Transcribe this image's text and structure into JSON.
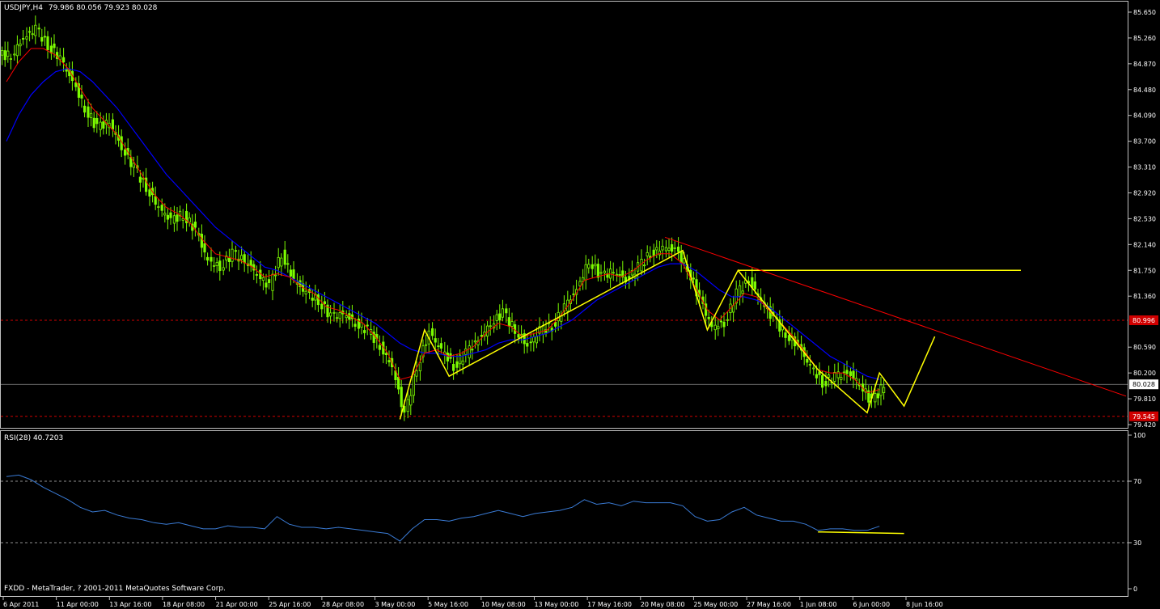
{
  "header": {
    "symbol": "USDJPY,H4",
    "ohlc": "79.986 80.056 79.923 80.028"
  },
  "footer": {
    "copyright": "FXDD - MetaTrader, ? 2001-2011 MetaQuotes Software Corp."
  },
  "colors": {
    "background": "#000000",
    "bull_candle": "#7cfc00",
    "ma_fast": "#ff0000",
    "ma_slow": "#0000ff",
    "pattern": "#ffff00",
    "trendline": "#ff0000",
    "rsi": "#3a7bd5",
    "grid_line": "#c0c0c0"
  },
  "chart_data": [
    {
      "type": "line",
      "panel": "price",
      "title": "USDJPY,H4",
      "y_ticks": [
        "85.650",
        "85.260",
        "84.870",
        "84.480",
        "84.090",
        "83.700",
        "83.310",
        "82.920",
        "82.530",
        "82.140",
        "81.750",
        "81.360",
        "80.590",
        "80.200",
        "79.810",
        "79.420"
      ],
      "ylim": [
        79.42,
        85.65
      ],
      "x_ticks": [
        "6 Apr 2011",
        "11 Apr 00:00",
        "13 Apr 16:00",
        "18 Apr 08:00",
        "21 Apr 00:00",
        "25 Apr 16:00",
        "28 Apr 08:00",
        "3 May 00:00",
        "5 May 16:00",
        "10 May 08:00",
        "13 May 00:00",
        "17 May 16:00",
        "20 May 08:00",
        "25 May 00:00",
        "27 May 16:00",
        "1 Jun 08:00",
        "6 Jun 00:00",
        "8 Jun 16:00"
      ],
      "price_labels": {
        "current": "80.028",
        "upper_level": "80.996",
        "lower_level": "79.545"
      },
      "levels": {
        "current": 80.028,
        "upper_level": 80.996,
        "lower_level": 79.545,
        "resistance": 81.75
      },
      "close_series": [
        {
          "x": 0,
          "y": 85.0
        },
        {
          "x": 1,
          "y": 85.25
        },
        {
          "x": 2,
          "y": 85.4
        },
        {
          "x": 3,
          "y": 85.15
        },
        {
          "x": 4,
          "y": 84.95
        },
        {
          "x": 5,
          "y": 84.6
        },
        {
          "x": 6,
          "y": 84.2
        },
        {
          "x": 7,
          "y": 83.9
        },
        {
          "x": 8,
          "y": 84.0
        },
        {
          "x": 9,
          "y": 83.6
        },
        {
          "x": 10,
          "y": 83.3
        },
        {
          "x": 11,
          "y": 83.0
        },
        {
          "x": 12,
          "y": 82.7
        },
        {
          "x": 13,
          "y": 82.5
        },
        {
          "x": 14,
          "y": 82.6
        },
        {
          "x": 15,
          "y": 82.35
        },
        {
          "x": 16,
          "y": 81.9
        },
        {
          "x": 17,
          "y": 81.8
        },
        {
          "x": 18,
          "y": 82.0
        },
        {
          "x": 19,
          "y": 81.9
        },
        {
          "x": 20,
          "y": 81.7
        },
        {
          "x": 21,
          "y": 81.5
        },
        {
          "x": 22,
          "y": 82.0
        },
        {
          "x": 23,
          "y": 81.6
        },
        {
          "x": 24,
          "y": 81.4
        },
        {
          "x": 25,
          "y": 81.3
        },
        {
          "x": 26,
          "y": 81.05
        },
        {
          "x": 27,
          "y": 81.1
        },
        {
          "x": 28,
          "y": 80.95
        },
        {
          "x": 29,
          "y": 80.85
        },
        {
          "x": 30,
          "y": 80.6
        },
        {
          "x": 31,
          "y": 80.3
        },
        {
          "x": 32,
          "y": 79.55
        },
        {
          "x": 33,
          "y": 80.3
        },
        {
          "x": 34,
          "y": 80.8
        },
        {
          "x": 35,
          "y": 80.55
        },
        {
          "x": 36,
          "y": 80.3
        },
        {
          "x": 37,
          "y": 80.5
        },
        {
          "x": 38,
          "y": 80.7
        },
        {
          "x": 39,
          "y": 80.95
        },
        {
          "x": 40,
          "y": 81.1
        },
        {
          "x": 41,
          "y": 80.85
        },
        {
          "x": 42,
          "y": 80.6
        },
        {
          "x": 43,
          "y": 80.85
        },
        {
          "x": 44,
          "y": 80.9
        },
        {
          "x": 45,
          "y": 81.2
        },
        {
          "x": 46,
          "y": 81.45
        },
        {
          "x": 47,
          "y": 81.9
        },
        {
          "x": 48,
          "y": 81.65
        },
        {
          "x": 49,
          "y": 81.75
        },
        {
          "x": 50,
          "y": 81.6
        },
        {
          "x": 51,
          "y": 81.8
        },
        {
          "x": 52,
          "y": 82.0
        },
        {
          "x": 53,
          "y": 82.1
        },
        {
          "x": 54,
          "y": 82.05
        },
        {
          "x": 55,
          "y": 81.8
        },
        {
          "x": 56,
          "y": 81.3
        },
        {
          "x": 57,
          "y": 80.9
        },
        {
          "x": 58,
          "y": 80.95
        },
        {
          "x": 59,
          "y": 81.4
        },
        {
          "x": 60,
          "y": 81.6
        },
        {
          "x": 61,
          "y": 81.3
        },
        {
          "x": 62,
          "y": 81.0
        },
        {
          "x": 63,
          "y": 80.8
        },
        {
          "x": 64,
          "y": 80.6
        },
        {
          "x": 65,
          "y": 80.3
        },
        {
          "x": 66,
          "y": 80.05
        },
        {
          "x": 67,
          "y": 80.15
        },
        {
          "x": 68,
          "y": 80.2
        },
        {
          "x": 69,
          "y": 80.05
        },
        {
          "x": 70,
          "y": 79.75
        },
        {
          "x": 71,
          "y": 80.03
        }
      ],
      "ma_fast_series": [
        84.6,
        84.9,
        85.1,
        85.1,
        85.0,
        84.8,
        84.5,
        84.2,
        84.0,
        83.8,
        83.5,
        83.2,
        82.9,
        82.7,
        82.6,
        82.45,
        82.2,
        82.0,
        81.95,
        81.9,
        81.8,
        81.65,
        81.7,
        81.65,
        81.5,
        81.4,
        81.2,
        81.15,
        81.05,
        80.95,
        80.75,
        80.5,
        80.1,
        80.15,
        80.5,
        80.55,
        80.45,
        80.5,
        80.6,
        80.8,
        80.95,
        80.9,
        80.75,
        80.8,
        80.85,
        81.05,
        81.3,
        81.6,
        81.65,
        81.7,
        81.65,
        81.75,
        81.9,
        82.0,
        82.0,
        81.85,
        81.5,
        81.15,
        81.0,
        81.2,
        81.4,
        81.35,
        81.15,
        80.95,
        80.75,
        80.5,
        80.25,
        80.2,
        80.2,
        80.1,
        79.9,
        79.95
      ],
      "ma_slow_series": [
        83.7,
        84.1,
        84.4,
        84.6,
        84.75,
        84.8,
        84.75,
        84.6,
        84.4,
        84.2,
        83.95,
        83.7,
        83.45,
        83.2,
        83.0,
        82.8,
        82.6,
        82.4,
        82.25,
        82.1,
        81.95,
        81.8,
        81.75,
        81.65,
        81.55,
        81.45,
        81.35,
        81.25,
        81.15,
        81.05,
        80.95,
        80.8,
        80.65,
        80.55,
        80.5,
        80.5,
        80.45,
        80.45,
        80.5,
        80.55,
        80.65,
        80.7,
        80.7,
        80.75,
        80.8,
        80.9,
        81.0,
        81.15,
        81.3,
        81.4,
        81.5,
        81.6,
        81.7,
        81.8,
        81.85,
        81.85,
        81.75,
        81.6,
        81.45,
        81.35,
        81.35,
        81.3,
        81.2,
        81.05,
        80.9,
        80.75,
        80.6,
        80.45,
        80.35,
        80.25,
        80.15,
        80.1
      ],
      "pattern_series": [
        {
          "x": 32,
          "y": 79.5
        },
        {
          "x": 34,
          "y": 80.85
        },
        {
          "x": 36,
          "y": 80.15
        },
        {
          "x": 55,
          "y": 82.05
        },
        {
          "x": 57,
          "y": 80.85
        },
        {
          "x": 59.5,
          "y": 81.75
        },
        {
          "x": 66,
          "y": 80.25
        },
        {
          "x": 70,
          "y": 79.6
        },
        {
          "x": 71,
          "y": 80.2
        },
        {
          "x": 73,
          "y": 79.7
        },
        {
          "x": 75.5,
          "y": 80.75
        }
      ],
      "trendline": [
        {
          "x": 54,
          "y": 82.25
        },
        {
          "x": 89,
          "y": 79.85
        }
      ]
    },
    {
      "type": "line",
      "panel": "rsi",
      "title": "RSI(28) 40.7203",
      "y_ticks": [
        "100",
        "70",
        "30",
        "0"
      ],
      "ylim": [
        0,
        100
      ],
      "x": [
        0,
        1,
        2,
        3,
        4,
        5,
        6,
        7,
        8,
        9,
        10,
        11,
        12,
        13,
        14,
        15,
        16,
        17,
        18,
        19,
        20,
        21,
        22,
        23,
        24,
        25,
        26,
        27,
        28,
        29,
        30,
        31,
        32,
        33,
        34,
        35,
        36,
        37,
        38,
        39,
        40,
        41,
        42,
        43,
        44,
        45,
        46,
        47,
        48,
        49,
        50,
        51,
        52,
        53,
        54,
        55,
        56,
        57,
        58,
        59,
        60,
        61,
        62,
        63,
        64,
        65,
        66,
        67,
        68,
        69,
        70,
        71
      ],
      "values": [
        73,
        74,
        71,
        66,
        62,
        58,
        53,
        50,
        51,
        48,
        46,
        45,
        43,
        42,
        43,
        41,
        39,
        39,
        41,
        40,
        40,
        39,
        47,
        42,
        40,
        40,
        39,
        40,
        39,
        38,
        37,
        36,
        31,
        39,
        45,
        45,
        44,
        46,
        47,
        49,
        51,
        49,
        47,
        49,
        50,
        51,
        53,
        58,
        55,
        56,
        54,
        57,
        56,
        56,
        56,
        54,
        47,
        44,
        45,
        50,
        53,
        48,
        46,
        44,
        44,
        42,
        38,
        39,
        39,
        38,
        38,
        40.7
      ],
      "support_line": [
        {
          "x": 66,
          "y": 37
        },
        {
          "x": 73,
          "y": 36
        }
      ]
    }
  ]
}
